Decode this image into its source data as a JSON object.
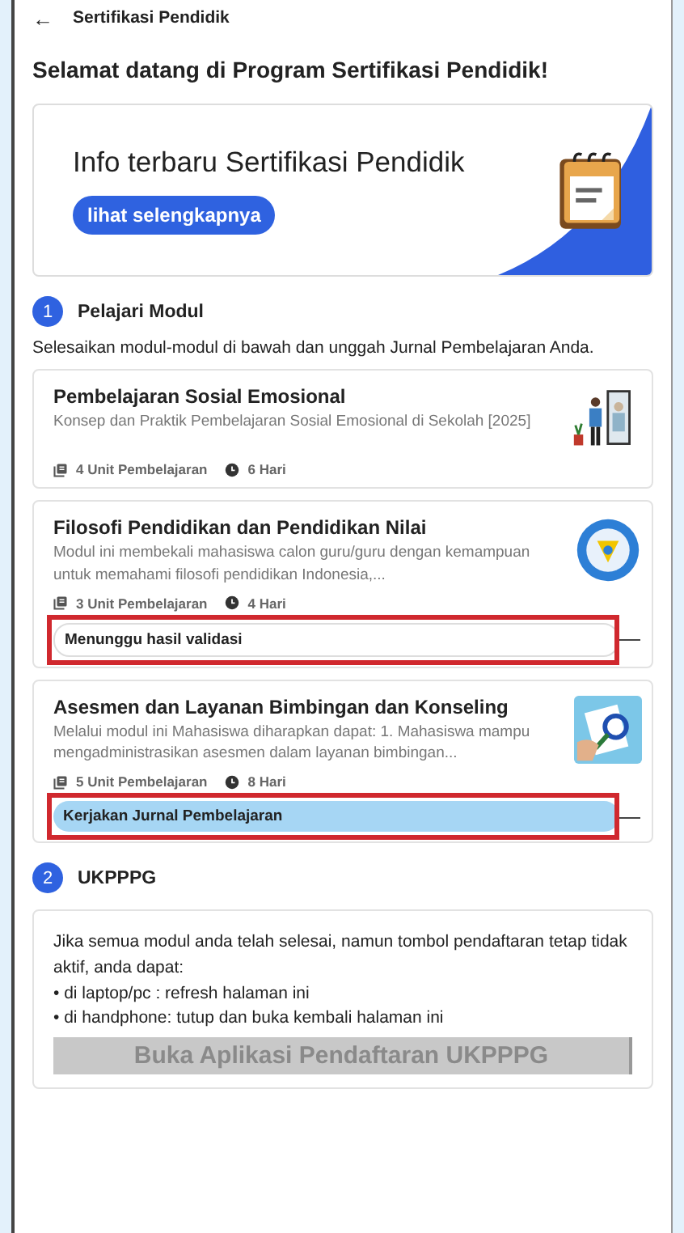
{
  "header": {
    "back_icon": "←",
    "title": "Sertifikasi Pendidik"
  },
  "welcome": "Selamat datang di Program Sertifikasi Pendidik!",
  "banner": {
    "title": "Info terbaru Sertifikasi Pendidik",
    "button": "lihat selengkapnya"
  },
  "steps": [
    {
      "number": "1",
      "title": "Pelajari Modul",
      "description": "Selesaikan modul-modul di bawah dan unggah Jurnal Pembelajaran Anda.",
      "modules": [
        {
          "title": "Pembelajaran Sosial Emosional",
          "description": "Konsep dan Praktik Pembelajaran Sosial Emosional di Sekolah [2025]",
          "units": "4 Unit Pembelajaran",
          "duration": "6 Hari",
          "highlighted": false
        },
        {
          "title": "Filosofi Pendidikan dan Pendidikan Nilai",
          "description": "Modul ini membekali mahasiswa calon guru/guru dengan kemampuan untuk memahami filosofi pendidikan Indonesia,...",
          "units": "3 Unit Pembelajaran",
          "duration": "4 Hari",
          "highlighted": true,
          "status": {
            "kind": "pending",
            "label": "Menunggu hasil validasi"
          }
        },
        {
          "title": "Asesmen dan Layanan Bimbingan dan Konseling",
          "description": "Melalui modul ini Mahasiswa diharapkan dapat: 1. Mahasiswa mampu mengadministrasikan asesmen dalam layanan bimbingan...",
          "units": "5 Unit Pembelajaran",
          "duration": "8 Hari",
          "highlighted": true,
          "status": {
            "kind": "action",
            "label": "Kerjakan Jurnal Pembelajaran"
          }
        }
      ]
    },
    {
      "number": "2",
      "title": "UKPPPG",
      "info": "Jika semua modul anda telah selesai, namun tombol pendaftaran tetap tidak aktif, anda dapat:",
      "bullets": [
        "• di laptop/pc : refresh halaman ini",
        "• di handphone: tutup dan buka kembali halaman ini"
      ],
      "button": {
        "label": "Buka Aplikasi Pendaftaran UKPPPG",
        "disabled": true
      }
    }
  ]
}
